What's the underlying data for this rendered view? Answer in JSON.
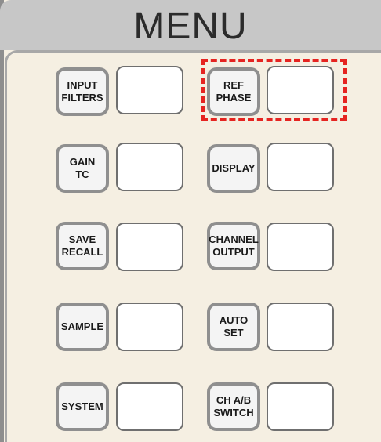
{
  "menu": {
    "title": "MENU"
  },
  "buttons": {
    "input_filters": "INPUT\nFILTERS",
    "ref_phase": "REF\nPHASE",
    "gain_tc": "GAIN\nTC",
    "display": "DISPLAY",
    "save_recall": "SAVE\nRECALL",
    "channel_output": "CHANNEL\nOUTPUT",
    "sample": "SAMPLE",
    "auto_set": "AUTO\nSET",
    "system": "SYSTEM",
    "ch_ab_switch": "CH A/B\nSWITCH"
  },
  "colors": {
    "panel_background": "#f5efe2",
    "header_background": "#c7c7c7",
    "button_border": "#8f8f8f",
    "highlight": "#e52421"
  },
  "highlight": {
    "target": "REF\nPHASE",
    "style": "red-dashed-box"
  }
}
